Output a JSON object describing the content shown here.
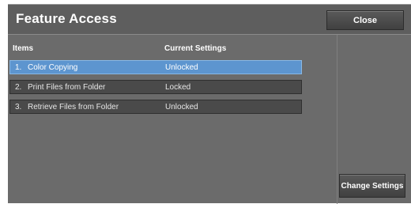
{
  "header": {
    "title": "Feature Access",
    "close_label": "Close"
  },
  "table": {
    "columns": [
      "Items",
      "Current Settings"
    ],
    "rows": [
      {
        "num": "1.",
        "name": "Color Copying",
        "setting": "Unlocked",
        "selected": true
      },
      {
        "num": "2.",
        "name": "Print Files from Folder",
        "setting": "Locked",
        "selected": false
      },
      {
        "num": "3.",
        "name": "Retrieve Files from Folder",
        "setting": "Unlocked",
        "selected": false
      }
    ]
  },
  "actions": {
    "change_settings_label": "Change Settings"
  },
  "colors": {
    "panel_bg": "#6b6b6b",
    "selected_row": "#5d95cf",
    "row_bg": "#4a4a4a"
  }
}
